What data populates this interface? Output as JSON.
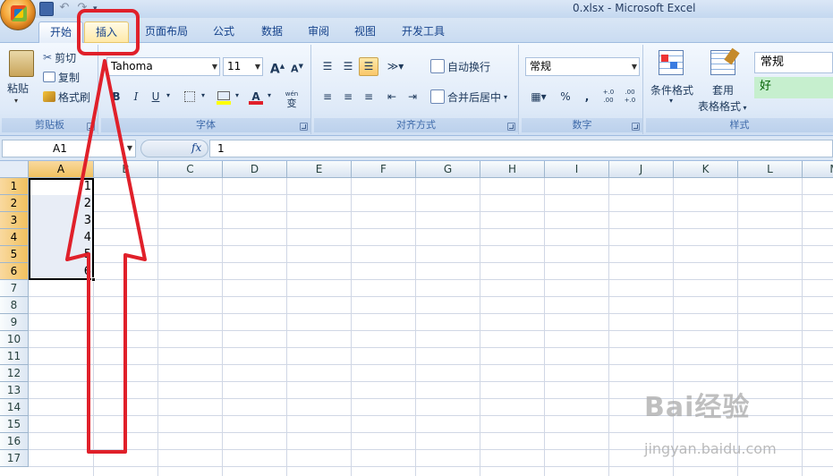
{
  "window": {
    "title": "0.xlsx - Microsoft Excel"
  },
  "tabs": [
    {
      "label": "开始",
      "state": "active"
    },
    {
      "label": "插入",
      "state": "highlighted"
    },
    {
      "label": "页面布局"
    },
    {
      "label": "公式"
    },
    {
      "label": "数据"
    },
    {
      "label": "审阅"
    },
    {
      "label": "视图"
    },
    {
      "label": "开发工具"
    }
  ],
  "ribbon": {
    "clipboard": {
      "label": "剪贴板",
      "paste": "粘贴",
      "cut": "剪切",
      "copy": "复制",
      "format_painter": "格式刷"
    },
    "font": {
      "label": "字体",
      "font_name": "Tahoma",
      "font_size": "11",
      "bold": "B",
      "italic": "I",
      "underline": "U",
      "grow": "A",
      "shrink": "A",
      "phonetic": "wén",
      "phonetic_char": "变"
    },
    "alignment": {
      "label": "对齐方式",
      "wrap_text": "自动换行",
      "merge_center": "合并后居中"
    },
    "number": {
      "label": "数字",
      "format": "常规",
      "percent": "%",
      "comma": ",",
      "inc_decimal": "+.0\n.00",
      "dec_decimal": ".00\n+.0"
    },
    "styles": {
      "label": "样式",
      "conditional": "条件格式",
      "table_format_line1": "套用",
      "table_format_line2": "表格格式",
      "style_normal": "常规",
      "style_good": "好"
    }
  },
  "formula_bar": {
    "name_box": "A1",
    "fx": "fx",
    "content": "1"
  },
  "grid": {
    "columns": [
      "A",
      "B",
      "C",
      "D",
      "E",
      "F",
      "G",
      "H",
      "I",
      "J",
      "K",
      "L",
      "M"
    ],
    "rows": [
      "1",
      "2",
      "3",
      "4",
      "5",
      "6",
      "7",
      "8",
      "9",
      "10",
      "11",
      "12",
      "13",
      "14",
      "15",
      "16",
      "17"
    ],
    "column_a_values": [
      "1",
      "2",
      "3",
      "4",
      "5",
      "6"
    ],
    "selected_range": "A1:A6"
  },
  "annotation": {
    "color": "#e0202a"
  },
  "watermark": {
    "brand": "Bai经验",
    "url": "jingyan.baidu.com"
  }
}
